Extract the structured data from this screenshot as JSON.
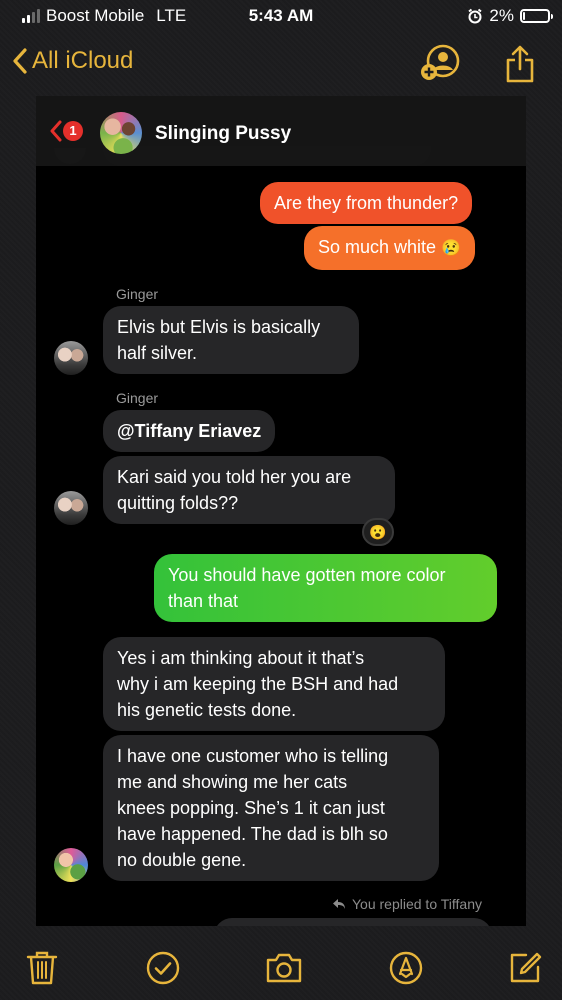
{
  "status_bar": {
    "carrier": "Boost Mobile",
    "network": "LTE",
    "time": "5:43 AM",
    "battery_percent": "2%",
    "battery_level": 0.02
  },
  "nav": {
    "back_label": "All iCloud",
    "back_icon": "chevron-left-icon",
    "share_icon": "share-icon",
    "collaborate_icon": "add-person-icon"
  },
  "colors": {
    "accent": "#e7b53c",
    "bubble_incoming": "#262628",
    "bubble_outgoing_orange": "#f0522a",
    "bubble_outgoing_green": "#4ec832",
    "badge": "#e5302b"
  },
  "chat": {
    "title": "Slinging Pussy",
    "unread_count": "1",
    "messages": [
      {
        "direction": "outgoing",
        "text": "Are they from thunder?"
      },
      {
        "direction": "outgoing",
        "text": "So much white",
        "emoji": "😢"
      },
      {
        "sender": "Ginger",
        "direction": "incoming",
        "text": "Elvis but Elvis is basically\nhalf silver."
      },
      {
        "sender": "Ginger",
        "direction": "incoming",
        "text": "@Tiffany Eriavez"
      },
      {
        "direction": "incoming",
        "text": "Kari said you told her you are\nquitting folds??",
        "reaction": "😮"
      },
      {
        "direction": "outgoing",
        "text": "You should have gotten more color\nthan that"
      },
      {
        "direction": "incoming",
        "text": "Yes i am thinking about it that’s\nwhy i am keeping the BSH and had\nhis genetic tests done."
      },
      {
        "direction": "incoming",
        "text": "I have one customer who is telling\nme and showing me her cats\nknees popping. She’s 1 it can just\nhave happened. The dad is blh so\nno double gene."
      }
    ],
    "reply_note": "You replied to Tiffany"
  },
  "toolbar": {
    "icons": [
      "trash-icon",
      "checkmark-icon",
      "camera-icon",
      "markup-icon",
      "compose-icon"
    ]
  }
}
